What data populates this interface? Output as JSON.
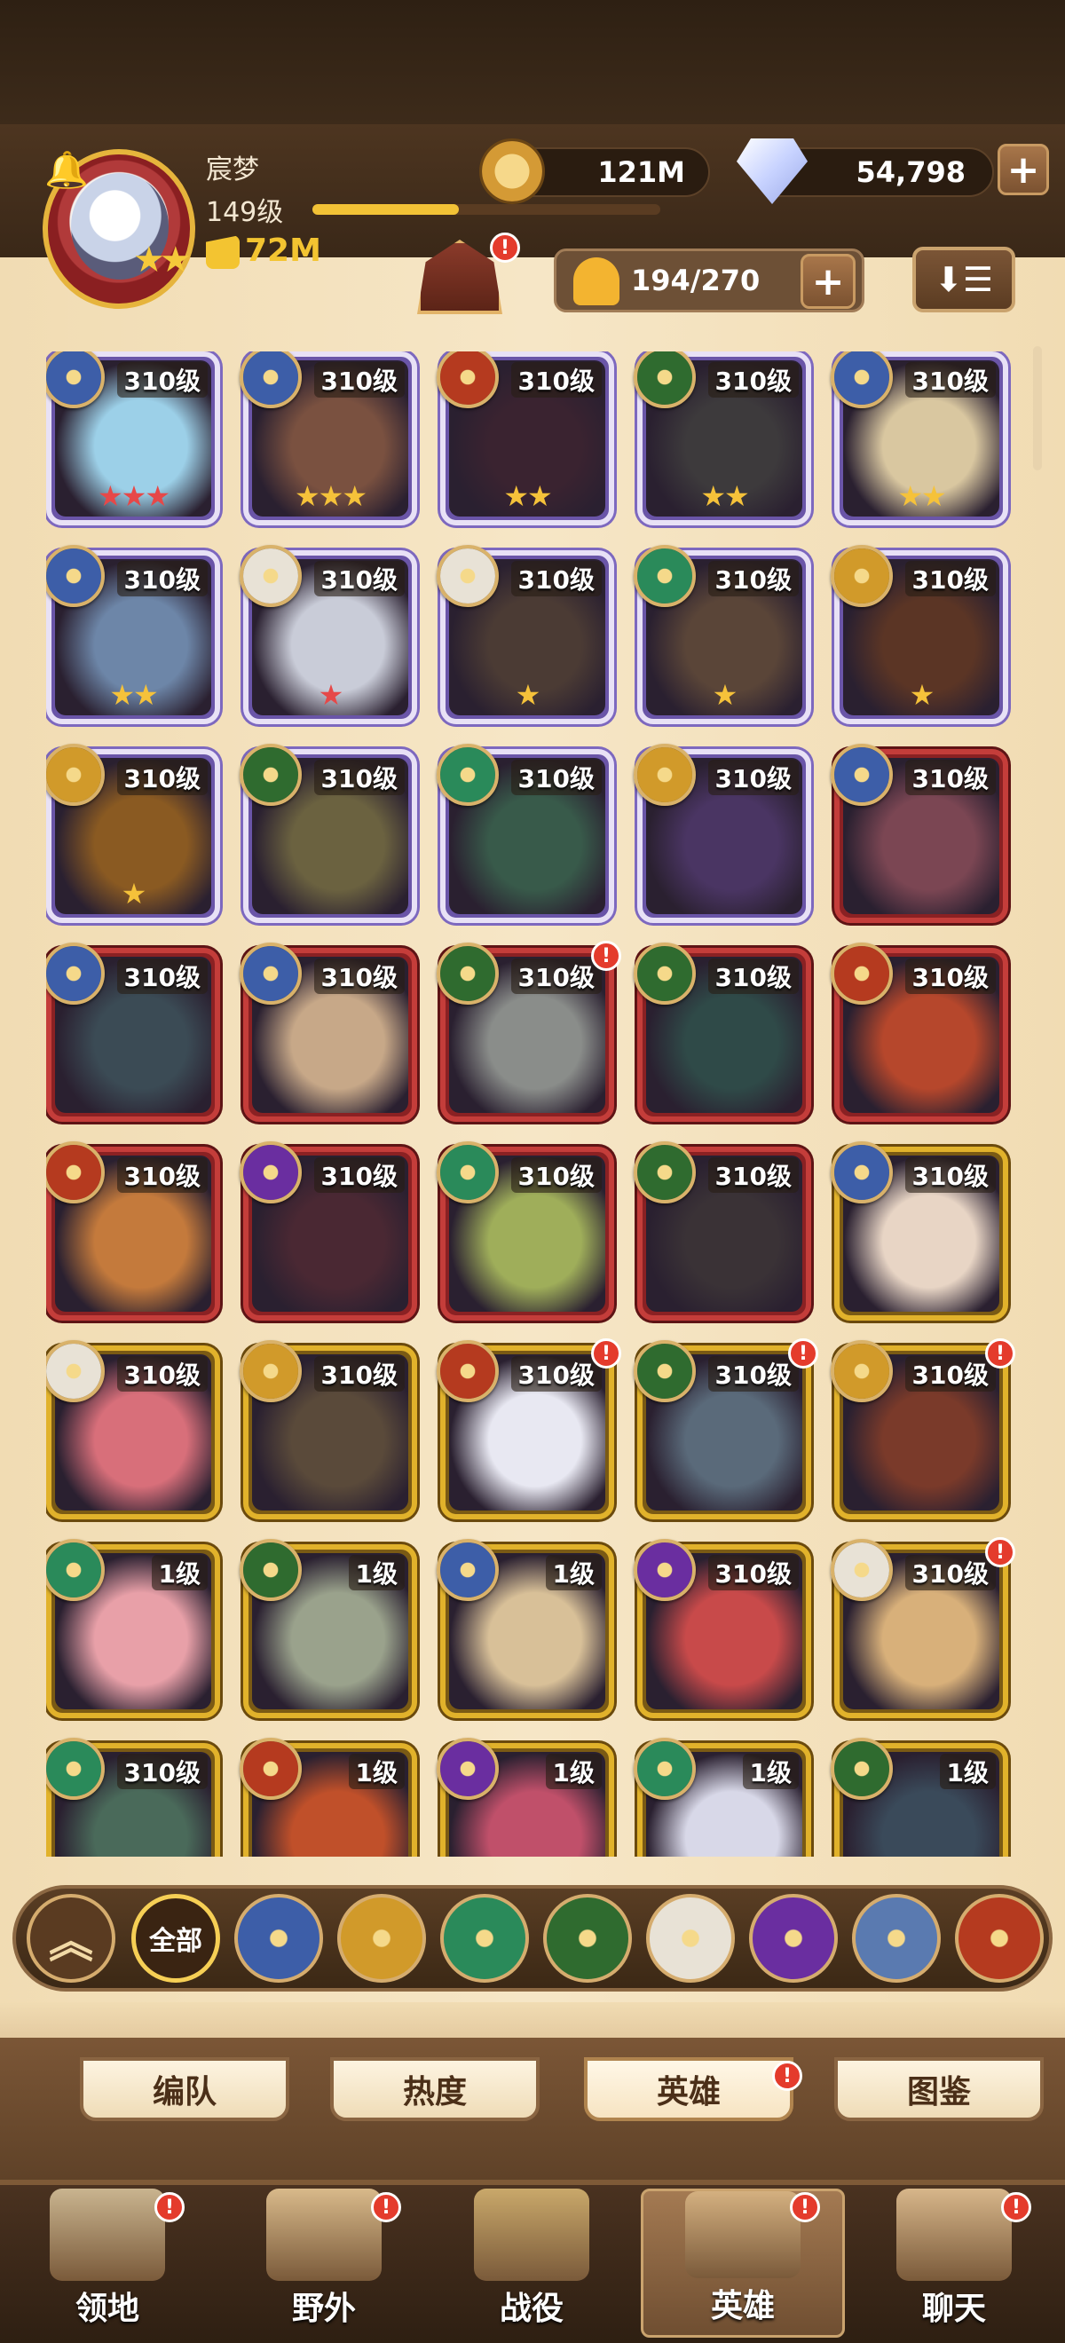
{
  "player": {
    "name": "宸梦",
    "level": "149级",
    "power": "72M",
    "xp_progress": 0.42
  },
  "resources": {
    "gold": "121M",
    "diamonds": "54,798",
    "gold_icon": "gold-coin-icon",
    "diamond_icon": "diamond-icon",
    "add_symbol": "+"
  },
  "hero_count": {
    "value": "194/270",
    "add_symbol": "+"
  },
  "sort_button": {
    "icon": "sort-icon",
    "glyph": "⬇☰"
  },
  "notification_glyph": "!",
  "heroes": [
    {
      "level": "310级",
      "frame": "purple",
      "faction": "celestial",
      "stars": "★★★",
      "star_color": "#e64848",
      "art": "#9cd0e8",
      "notice": false
    },
    {
      "level": "310级",
      "frame": "purple",
      "faction": "celestial",
      "stars": "★★★",
      "star_color": "#f5c23a",
      "art": "#7a5140",
      "notice": false
    },
    {
      "level": "310级",
      "frame": "purple",
      "faction": "inferno",
      "stars": "★★",
      "star_color": "#f5c23a",
      "art": "#3a2330",
      "notice": false
    },
    {
      "level": "310级",
      "frame": "purple",
      "faction": "nature",
      "stars": "★★",
      "star_color": "#f5c23a",
      "art": "#3d3a3c",
      "notice": false
    },
    {
      "level": "310级",
      "frame": "purple",
      "faction": "celestial",
      "stars": "★★",
      "star_color": "#f5c23a",
      "art": "#d9c7a0",
      "notice": false
    },
    {
      "level": "310级",
      "frame": "purple",
      "faction": "celestial",
      "stars": "★★",
      "star_color": "#f5c23a",
      "art": "#6d86a8",
      "notice": false
    },
    {
      "level": "310级",
      "frame": "purple",
      "faction": "light",
      "stars": "★",
      "star_color": "#e64848",
      "art": "#c9ccd8",
      "notice": false
    },
    {
      "level": "310级",
      "frame": "purple",
      "faction": "light",
      "stars": "★",
      "star_color": "#f5c23a",
      "art": "#4b3b34",
      "notice": false
    },
    {
      "level": "310级",
      "frame": "purple",
      "faction": "forest",
      "stars": "★",
      "star_color": "#f5c23a",
      "art": "#5a4538",
      "notice": false
    },
    {
      "level": "310级",
      "frame": "purple",
      "faction": "radiant",
      "stars": "★",
      "star_color": "#f5c23a",
      "art": "#5b3525",
      "notice": false
    },
    {
      "level": "310级",
      "frame": "purple",
      "faction": "radiant",
      "stars": "★",
      "star_color": "#f5c23a",
      "art": "#8a5a22",
      "notice": false
    },
    {
      "level": "310级",
      "frame": "purple",
      "faction": "nature",
      "stars": "",
      "star_color": "#f5c23a",
      "art": "#6b6240",
      "notice": false
    },
    {
      "level": "310级",
      "frame": "purple",
      "faction": "forest",
      "stars": "",
      "star_color": "#f5c23a",
      "art": "#385a4a",
      "notice": false
    },
    {
      "level": "310级",
      "frame": "purple",
      "faction": "radiant",
      "stars": "",
      "star_color": "#f5c23a",
      "art": "#4a3563",
      "notice": false
    },
    {
      "level": "310级",
      "frame": "red",
      "faction": "celestial",
      "stars": "",
      "star_color": "#f5c23a",
      "art": "#7b4653",
      "notice": false
    },
    {
      "level": "310级",
      "frame": "red",
      "faction": "celestial",
      "stars": "",
      "star_color": "#f5c23a",
      "art": "#3b4b55",
      "notice": false
    },
    {
      "level": "310级",
      "frame": "red",
      "faction": "celestial",
      "stars": "",
      "star_color": "#f5c23a",
      "art": "#c7a888",
      "notice": false
    },
    {
      "level": "310级",
      "frame": "red",
      "faction": "nature",
      "stars": "",
      "star_color": "#f5c23a",
      "art": "#8a8d8a",
      "notice": true
    },
    {
      "level": "310级",
      "frame": "red",
      "faction": "nature",
      "stars": "",
      "star_color": "#f5c23a",
      "art": "#2f4a48",
      "notice": false
    },
    {
      "level": "310级",
      "frame": "red",
      "faction": "inferno",
      "stars": "",
      "star_color": "#f5c23a",
      "art": "#b6472c",
      "notice": false
    },
    {
      "level": "310级",
      "frame": "red",
      "faction": "inferno",
      "stars": "",
      "star_color": "#f5c23a",
      "art": "#c47a3c",
      "notice": false
    },
    {
      "level": "310级",
      "frame": "red",
      "faction": "shadow",
      "stars": "",
      "star_color": "#f5c23a",
      "art": "#4a2833",
      "notice": false
    },
    {
      "level": "310级",
      "frame": "red",
      "faction": "forest",
      "stars": "",
      "star_color": "#f5c23a",
      "art": "#9fae5a",
      "notice": false
    },
    {
      "level": "310级",
      "frame": "red",
      "faction": "nature",
      "stars": "",
      "star_color": "#f5c23a",
      "art": "#3a3236",
      "notice": false
    },
    {
      "level": "310级",
      "frame": "gold",
      "faction": "celestial",
      "stars": "",
      "star_color": "#f5c23a",
      "art": "#e8d5c5",
      "notice": false
    },
    {
      "level": "310级",
      "frame": "gold",
      "faction": "light",
      "stars": "",
      "star_color": "#f5c23a",
      "art": "#d86f7a",
      "notice": false
    },
    {
      "level": "310级",
      "frame": "gold",
      "faction": "radiant",
      "stars": "",
      "star_color": "#f5c23a",
      "art": "#5a4a3a",
      "notice": false
    },
    {
      "level": "310级",
      "frame": "gold",
      "faction": "inferno",
      "stars": "",
      "star_color": "#f5c23a",
      "art": "#e8e8f2",
      "notice": true
    },
    {
      "level": "310级",
      "frame": "gold",
      "faction": "nature",
      "stars": "",
      "star_color": "#f5c23a",
      "art": "#5a6a7a",
      "notice": true
    },
    {
      "level": "310级",
      "frame": "gold",
      "faction": "radiant",
      "stars": "",
      "star_color": "#f5c23a",
      "art": "#7a3a2a",
      "notice": true
    },
    {
      "level": "1级",
      "frame": "gold",
      "faction": "forest",
      "stars": "",
      "star_color": "#f5c23a",
      "art": "#e8a0a8",
      "notice": false
    },
    {
      "level": "1级",
      "frame": "gold",
      "faction": "nature",
      "stars": "",
      "star_color": "#f5c23a",
      "art": "#9aa28c",
      "notice": false
    },
    {
      "level": "1级",
      "frame": "gold",
      "faction": "celestial",
      "stars": "",
      "star_color": "#f5c23a",
      "art": "#d8c098",
      "notice": false
    },
    {
      "level": "310级",
      "frame": "gold",
      "faction": "shadow",
      "stars": "",
      "star_color": "#f5c23a",
      "art": "#c84a4a",
      "notice": false
    },
    {
      "level": "310级",
      "frame": "gold",
      "faction": "light",
      "stars": "",
      "star_color": "#f5c23a",
      "art": "#d8b07a",
      "notice": true
    },
    {
      "level": "310级",
      "frame": "gold",
      "faction": "forest",
      "stars": "",
      "star_color": "#f5c23a",
      "art": "#4a6a5a",
      "notice": false
    },
    {
      "level": "1级",
      "frame": "gold",
      "faction": "inferno",
      "stars": "",
      "star_color": "#f5c23a",
      "art": "#c0502a",
      "notice": false
    },
    {
      "level": "1级",
      "frame": "gold",
      "faction": "shadow",
      "stars": "",
      "star_color": "#f5c23a",
      "art": "#c0506a",
      "notice": false
    },
    {
      "level": "1级",
      "frame": "gold",
      "faction": "forest",
      "stars": "",
      "star_color": "#f5c23a",
      "art": "#d8d8e8",
      "notice": false
    },
    {
      "level": "1级",
      "frame": "gold",
      "faction": "nature",
      "stars": "",
      "star_color": "#f5c23a",
      "art": "#3a4a5a",
      "notice": false
    }
  ],
  "faction_colors": {
    "celestial": "#3d5ea8",
    "inferno": "#b53a1f",
    "nature": "#2f6b2f",
    "light": "#e8e2d6",
    "forest": "#2a8a5a",
    "radiant": "#d19a2a",
    "shadow": "#6a2ea0"
  },
  "filters": {
    "up_label": "︽",
    "all_label": "全部",
    "items": [
      {
        "name": "celestial",
        "color": "#3d5ea8"
      },
      {
        "name": "radiant",
        "color": "#d19a2a"
      },
      {
        "name": "forest",
        "color": "#2a8a5a"
      },
      {
        "name": "nature",
        "color": "#2f6b2f"
      },
      {
        "name": "light",
        "color": "#e8e2d6"
      },
      {
        "name": "shadow",
        "color": "#6a2ea0"
      },
      {
        "name": "mech",
        "color": "#5a7ab0"
      },
      {
        "name": "inferno",
        "color": "#b53a1f"
      }
    ]
  },
  "subtabs": [
    {
      "label": "编队",
      "active": false,
      "notice": false
    },
    {
      "label": "热度",
      "active": false,
      "notice": false
    },
    {
      "label": "英雄",
      "active": true,
      "notice": true
    },
    {
      "label": "图鉴",
      "active": false,
      "notice": false
    }
  ],
  "bottom_nav": [
    {
      "label": "领地",
      "icon": "castle-icon",
      "notice": true,
      "active": false
    },
    {
      "label": "野外",
      "icon": "map-scroll-icon",
      "notice": true,
      "active": false
    },
    {
      "label": "战役",
      "icon": "sword-icon",
      "notice": false,
      "active": false
    },
    {
      "label": "英雄",
      "icon": "helmet-icon",
      "notice": true,
      "active": true
    },
    {
      "label": "聊天",
      "icon": "chat-icon",
      "notice": true,
      "active": false
    }
  ]
}
